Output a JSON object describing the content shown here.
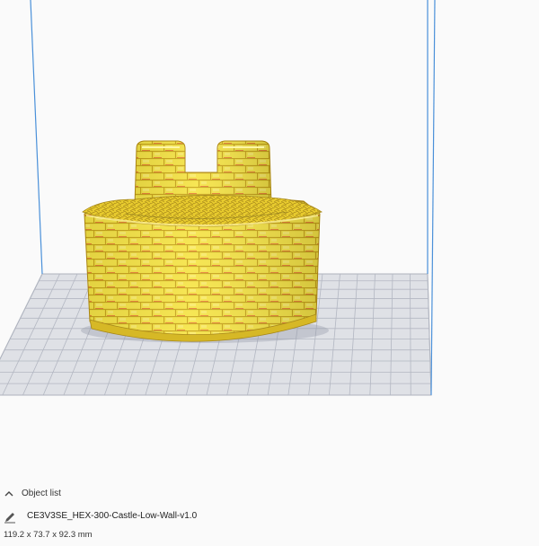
{
  "object_list": {
    "label": "Object list",
    "toggle_icon": "chevron-up-icon"
  },
  "object": {
    "name": "CE3V3SE_HEX-300-Castle-Low-Wall-v1.0",
    "edit_icon": "pencil-icon",
    "dimensions": "119.2 x 73.7 x 92.3 mm"
  },
  "colors": {
    "model": "#f3e03b",
    "model_shadow": "#d4b21c",
    "overhang": "#e03a2c",
    "plate_grid": "#b8bcc8",
    "build_volume_edge": "#4a90d9",
    "background": "#fafafa"
  }
}
